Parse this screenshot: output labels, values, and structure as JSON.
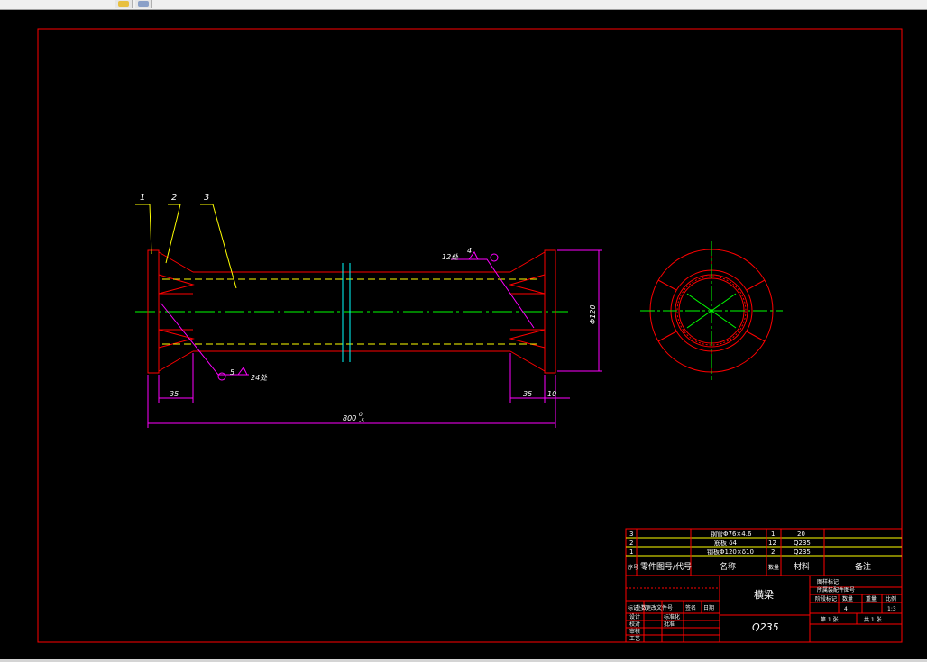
{
  "toolbar": {
    "buttons": [
      {
        "name": "toolbar-button-layer",
        "icon": "layer-icon"
      },
      {
        "name": "toolbar-button-3d",
        "icon": "cube-icon"
      }
    ]
  },
  "colors": {
    "background": "#000000",
    "frame": "#ff0000",
    "outline": "#ff0000",
    "hidden": "#ffff00",
    "centerline": "#00ff00",
    "dimension": "#ff00ff",
    "cyan": "#00ffff",
    "text": "#ffff00",
    "white_text": "#ffffff"
  },
  "drawing": {
    "balloons": [
      "1",
      "2",
      "3"
    ],
    "weld_top": {
      "size": "4",
      "length": "12处"
    },
    "weld_bottom": {
      "size": "5",
      "length": "24处"
    },
    "dims": {
      "left_35": "35",
      "right_35": "35",
      "right_10": "10",
      "overall": "800",
      "overall_tol_upper": "0",
      "overall_tol_lower": "-5",
      "diameter": "Φ120"
    }
  },
  "parts_list": {
    "rows": [
      {
        "no": "3",
        "name": "钢管Φ76×4.6",
        "qty": "1",
        "material": "20",
        "note": ""
      },
      {
        "no": "2",
        "name": "筋板 δ4",
        "qty": "12",
        "material": "Q235",
        "note": ""
      },
      {
        "no": "1",
        "name": "钢板Φ120×δ10",
        "qty": "2",
        "material": "Q235",
        "note": ""
      }
    ],
    "header": {
      "no": "序号",
      "code": "零件图号/代号",
      "name": "名称",
      "qty": "数量",
      "material": "材料",
      "note": "备注"
    }
  },
  "title_block": {
    "drawing_name": "横梁",
    "material": "Q235",
    "rev_headers": [
      "标记",
      "处数",
      "更改文件号",
      "签名",
      "日期"
    ],
    "roles": [
      "设计",
      "校对",
      "审核",
      "工艺"
    ],
    "role_right": [
      "标准化",
      "批准"
    ],
    "assembly_label": "图样标记",
    "assembly_code": "所属装配件图号",
    "cols": [
      "阶段标记",
      "数量",
      "重量",
      "比例"
    ],
    "qty": "4",
    "scale": "1:3",
    "sheet": "第 1 张",
    "sheets": "共 1 张"
  }
}
